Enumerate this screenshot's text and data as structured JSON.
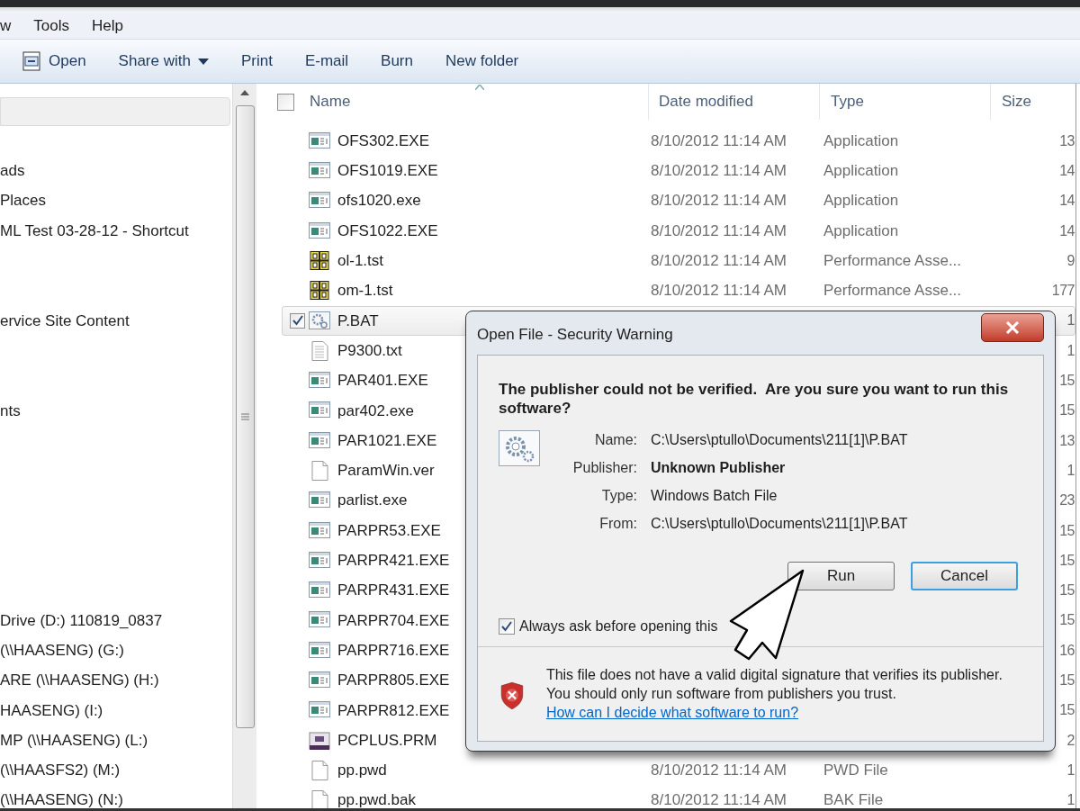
{
  "menu_bar": [
    {
      "label": "w"
    },
    {
      "label": "Tools"
    },
    {
      "label": "Help"
    }
  ],
  "toolbar": [
    {
      "label": "Open",
      "kind": "icon"
    },
    {
      "label": "Share with",
      "kind": "dropdown"
    },
    {
      "label": "Print",
      "kind": "plain"
    },
    {
      "label": "E-mail",
      "kind": "plain"
    },
    {
      "label": "Burn",
      "kind": "plain"
    },
    {
      "label": "New folder",
      "kind": "plain"
    }
  ],
  "nav_pane": {
    "items": [
      {
        "label": "ads"
      },
      {
        "label": "Places"
      },
      {
        "label": "ML Test 03-28-12 - Shortcut"
      },
      {
        "label": "ervice Site Content"
      },
      {
        "label": "nts"
      },
      {
        "label": "Drive (D:) 110819_0837"
      },
      {
        "label": "(\\\\HAASENG) (G:)"
      },
      {
        "label": "ARE (\\\\HAASENG) (H:)"
      },
      {
        "label": "HAASENG) (I:)"
      },
      {
        "label": "MP (\\\\HAASENG) (L:)"
      },
      {
        "label": "(\\\\HAASFS2) (M:)"
      },
      {
        "label": "(\\\\HAASENG) (N:)"
      }
    ]
  },
  "file_list": {
    "select_all": {
      "checked": false
    },
    "columns": [
      {
        "label": "Name",
        "sorted": true
      },
      {
        "label": "Date modified",
        "sorted": false
      },
      {
        "label": "Type",
        "sorted": false
      },
      {
        "label": "Size",
        "sorted": false
      }
    ],
    "rows": [
      {
        "kind": "exe",
        "name": "OFS302.EXE",
        "date": "8/10/2012 11:14 AM",
        "type": "Application",
        "size": "13",
        "selected": false
      },
      {
        "kind": "exe",
        "name": "OFS1019.EXE",
        "date": "8/10/2012 11:14 AM",
        "type": "Application",
        "size": "14",
        "selected": false
      },
      {
        "kind": "exe",
        "name": "ofs1020.exe",
        "date": "8/10/2012 11:14 AM",
        "type": "Application",
        "size": "14",
        "selected": false
      },
      {
        "kind": "exe",
        "name": "OFS1022.EXE",
        "date": "8/10/2012 11:14 AM",
        "type": "Application",
        "size": "14",
        "selected": false
      },
      {
        "kind": "tst",
        "name": "ol-1.tst",
        "date": "8/10/2012 11:14 AM",
        "type": "Performance Asse...",
        "size": "9",
        "selected": false
      },
      {
        "kind": "tst",
        "name": "om-1.tst",
        "date": "8/10/2012 11:14 AM",
        "type": "Performance Asse...",
        "size": "177",
        "selected": false
      },
      {
        "kind": "bat",
        "name": "P.BAT",
        "size": "1",
        "selected": true
      },
      {
        "kind": "txt",
        "name": "P9300.txt",
        "size": "1",
        "selected": false
      },
      {
        "kind": "exe",
        "name": "PAR401.EXE",
        "size": "15",
        "selected": false
      },
      {
        "kind": "exe",
        "name": "par402.exe",
        "size": "15",
        "selected": false
      },
      {
        "kind": "exe",
        "name": "PAR1021.EXE",
        "size": "13",
        "selected": false
      },
      {
        "kind": "blank",
        "name": "ParamWin.ver",
        "size": "1",
        "selected": false
      },
      {
        "kind": "exe",
        "name": "parlist.exe",
        "size": "23",
        "selected": false
      },
      {
        "kind": "exe",
        "name": "PARPR53.EXE",
        "size": "15",
        "selected": false
      },
      {
        "kind": "exe",
        "name": "PARPR421.EXE",
        "size": "15",
        "selected": false
      },
      {
        "kind": "exe",
        "name": "PARPR431.EXE",
        "size": "15",
        "selected": false
      },
      {
        "kind": "exe",
        "name": "PARPR704.EXE",
        "size": "15",
        "selected": false
      },
      {
        "kind": "exe",
        "name": "PARPR716.EXE",
        "size": "16",
        "selected": false
      },
      {
        "kind": "exe",
        "name": "PARPR805.EXE",
        "size": "15",
        "selected": false
      },
      {
        "kind": "exe",
        "name": "PARPR812.EXE",
        "size": "15",
        "selected": false
      },
      {
        "kind": "prm",
        "name": "PCPLUS.PRM",
        "size": "2",
        "selected": false
      },
      {
        "kind": "blank",
        "name": "pp.pwd",
        "date": "8/10/2012 11:14 AM",
        "type": "PWD File",
        "size": "1",
        "selected": false
      },
      {
        "kind": "blank",
        "name": "pp.pwd.bak",
        "date": "8/10/2012 11:14 AM",
        "type": "BAK File",
        "size": "1",
        "selected": false
      }
    ]
  },
  "dialog": {
    "title": "Open File - Security Warning",
    "heading": "The publisher could not be verified.  Are you sure you want to run this software?",
    "fields": [
      {
        "label": "Name:",
        "value": "C:\\Users\\ptullo\\Documents\\211[1]\\P.BAT",
        "bold": false
      },
      {
        "label": "Publisher:",
        "value": "Unknown Publisher",
        "bold": true
      },
      {
        "label": "Type:",
        "value": "Windows Batch File",
        "bold": false
      },
      {
        "label": "From:",
        "value": "C:\\Users\\ptullo\\Documents\\211[1]\\P.BAT",
        "bold": false
      }
    ],
    "buttons": [
      {
        "label": "Run",
        "focused": false
      },
      {
        "label": "Cancel",
        "focused": true
      }
    ],
    "always_ask": {
      "label": "Always ask before opening this",
      "checked": true
    },
    "warning_text": "This file does not have a valid digital signature that verifies its publisher.  You should only run software from publishers you trust.",
    "help_link": "How can I decide what software to run?"
  }
}
